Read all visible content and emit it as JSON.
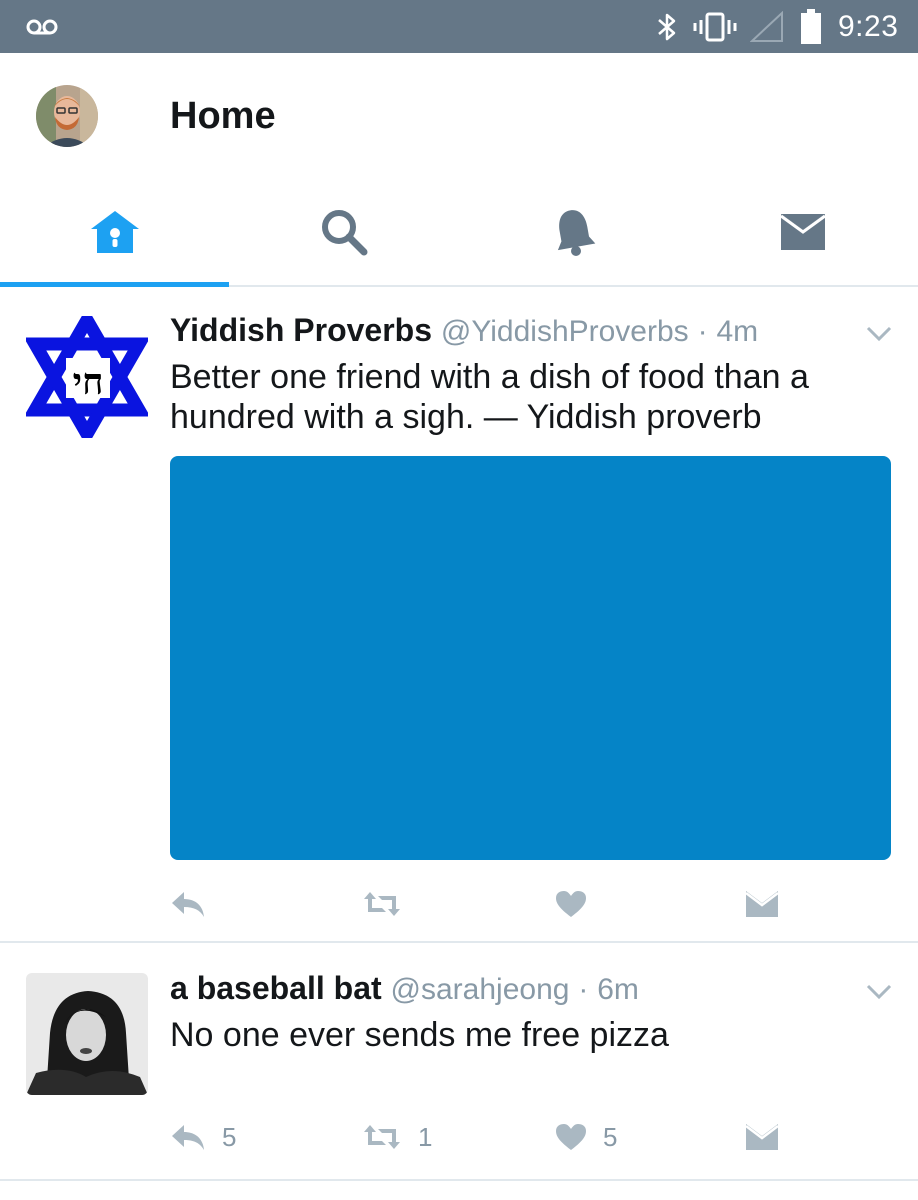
{
  "status_bar": {
    "time": "9:23",
    "icons": [
      "voicemail-icon",
      "bluetooth-icon",
      "vibrate-icon",
      "signal-icon",
      "battery-icon"
    ]
  },
  "header": {
    "title": "Home"
  },
  "tabs": [
    {
      "name": "home",
      "icon": "home-icon",
      "active": true
    },
    {
      "name": "search",
      "icon": "search-icon",
      "active": false
    },
    {
      "name": "notifications",
      "icon": "bell-icon",
      "active": false
    },
    {
      "name": "messages",
      "icon": "envelope-icon",
      "active": false
    }
  ],
  "timeline": {
    "tweets": [
      {
        "name": "Yiddish Proverbs",
        "handle": "@YiddishProverbs",
        "separator": "·",
        "time": "4m",
        "text": "Better one friend with a dish of food than a hundred with a sigh. — Yiddish proverb",
        "has_media": true,
        "media_color": "#0584c7",
        "counts": {
          "replies": "",
          "retweets": "",
          "likes": ""
        },
        "avatar_icon": "star-of-david-chai-icon"
      },
      {
        "name": "a baseball bat",
        "handle": "@sarahjeong",
        "separator": "·",
        "time": "6m",
        "text": "No one ever sends me free pizza",
        "has_media": false,
        "counts": {
          "replies": "5",
          "retweets": "1",
          "likes": "5"
        },
        "avatar_icon": "profile-photo"
      }
    ]
  },
  "colors": {
    "status_bar": "#657787",
    "accent": "#1da1f2",
    "icon_gray": "#657787",
    "action_gray": "#aab8c2",
    "secondary_text": "#8899a6",
    "divider": "#e1e8ed"
  }
}
